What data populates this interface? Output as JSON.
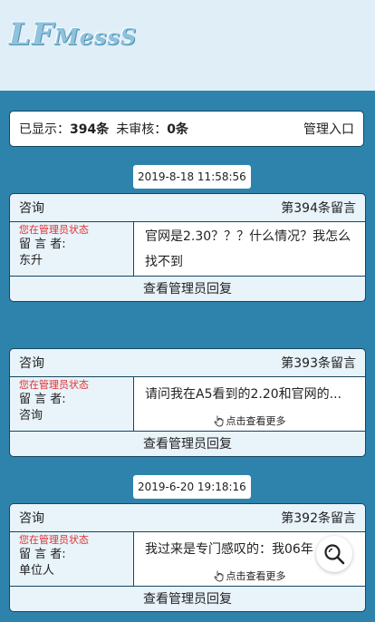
{
  "logo": {
    "text_big": "LF",
    "text_small": "MessS"
  },
  "stats": {
    "shown_label": "已显示：",
    "shown_count": "394条",
    "pending_label": "未审核：",
    "pending_count": "0条",
    "admin_entry": "管理入口"
  },
  "messages": [
    {
      "date": "2019-8-18 11:58:56",
      "category": "咨询",
      "number_label": "第394条留言",
      "admin_state": "您在管理员状态",
      "author_label": "留 言 者:",
      "author": "东升",
      "content": "官网是2.30？？？什么情况？我怎么找不到",
      "more": "",
      "reply_label": "查看管理员回复"
    },
    {
      "date": "",
      "category": "咨询",
      "number_label": "第393条留言",
      "admin_state": "您在管理员状态",
      "author_label": "留 言 者:",
      "author": "咨询",
      "content": "请问我在A5看到的2.20和官网的...",
      "more": "点击查看更多",
      "reply_label": "查看管理员回复"
    },
    {
      "date": "2019-6-20 19:18:16",
      "category": "咨询",
      "number_label": "第392条留言",
      "admin_state": "您在管理员状态",
      "author_label": "留 言 者:",
      "author": "单位人",
      "content": "我过来是专门感叹的：我06年",
      "more": "点击查看更多",
      "reply_label": "查看管理员回复"
    }
  ],
  "icons": {
    "search": "search-icon",
    "hand": "hand-pointer-icon"
  }
}
